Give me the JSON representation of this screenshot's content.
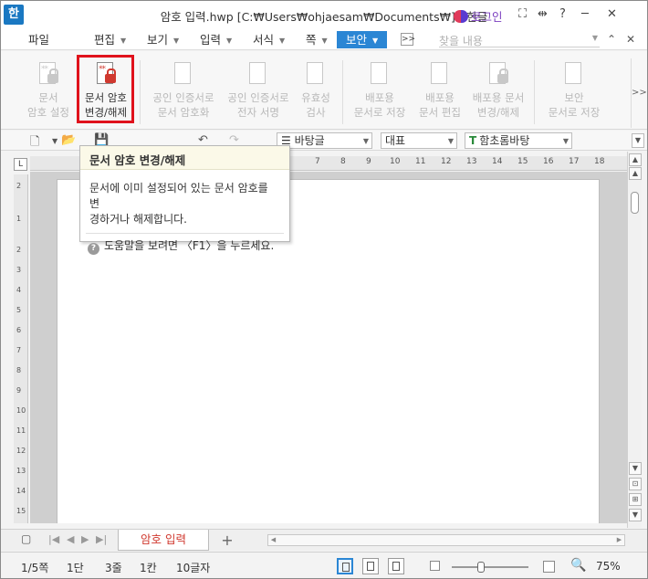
{
  "titlebar": {
    "app_icon": "한",
    "title": "암호 입력.hwp [C:₩Users₩ohjaesam₩Documents₩] - 한글",
    "login": "로그인",
    "icons": [
      "fullscreen-icon",
      "split-icon",
      "help-icon",
      "minimize-icon",
      "close-icon"
    ],
    "help_label": "?"
  },
  "menubar": {
    "items": [
      "파일",
      "편집",
      "보기",
      "입력",
      "서식",
      "쪽",
      "보안"
    ],
    "active": "보안",
    "more_label": ">>",
    "search_placeholder": "찾을 내용"
  },
  "ribbon": {
    "buttons": [
      {
        "line1": "문서",
        "line2": "암호 설정",
        "enabled": false
      },
      {
        "line1": "문서 암호",
        "line2": "변경/해제",
        "enabled": true
      },
      {
        "line1": "공인 인증서로",
        "line2": "문서 암호화",
        "enabled": false
      },
      {
        "line1": "공인 인증서로",
        "line2": "전자 서명",
        "enabled": false
      },
      {
        "line1": "유효성",
        "line2": "검사",
        "enabled": false
      },
      {
        "line1": "배포용",
        "line2": "문서로 저장",
        "enabled": false
      },
      {
        "line1": "배포용",
        "line2": "문서 편집",
        "enabled": false
      },
      {
        "line1": "배포용 문서",
        "line2": "변경/해제",
        "enabled": false
      },
      {
        "line1": "보안",
        "line2": "문서로 저장",
        "enabled": false
      }
    ],
    "more_label": ">>",
    "highlight_color": "#e0121c"
  },
  "toolbar": {
    "style_combo": "바탕글",
    "lang_combo": "대표",
    "font_combo": "함초롬바탕",
    "font_icon": "T"
  },
  "ruler": {
    "h_labels": [
      "7",
      "8",
      "9",
      "10",
      "11",
      "12",
      "13",
      "14",
      "15",
      "16",
      "17",
      "18"
    ],
    "v_labels": [
      "2",
      "1",
      "2",
      "3",
      "4",
      "5",
      "6",
      "7",
      "8",
      "9",
      "10",
      "11",
      "12",
      "13",
      "14",
      "15"
    ],
    "corner": "L"
  },
  "tooltip": {
    "title": "문서 암호 변경/해제",
    "body_line1": "문서에 이미 설정되어 있는 문서 암호를 변",
    "body_line2": "경하거나 해제합니다.",
    "help": "도움말을 보려면 〈F1〉을 누르세요.",
    "help_icon": "?"
  },
  "tabbar": {
    "tab": "암호 입력",
    "add": "+"
  },
  "statusbar": {
    "page": "1/5쪽",
    "section": "1단",
    "line": "3줄",
    "column": "1칸",
    "chars": "10글자",
    "zoom": "75%"
  },
  "colors": {
    "accent": "#2b86d4",
    "lock": "#d0392f"
  }
}
